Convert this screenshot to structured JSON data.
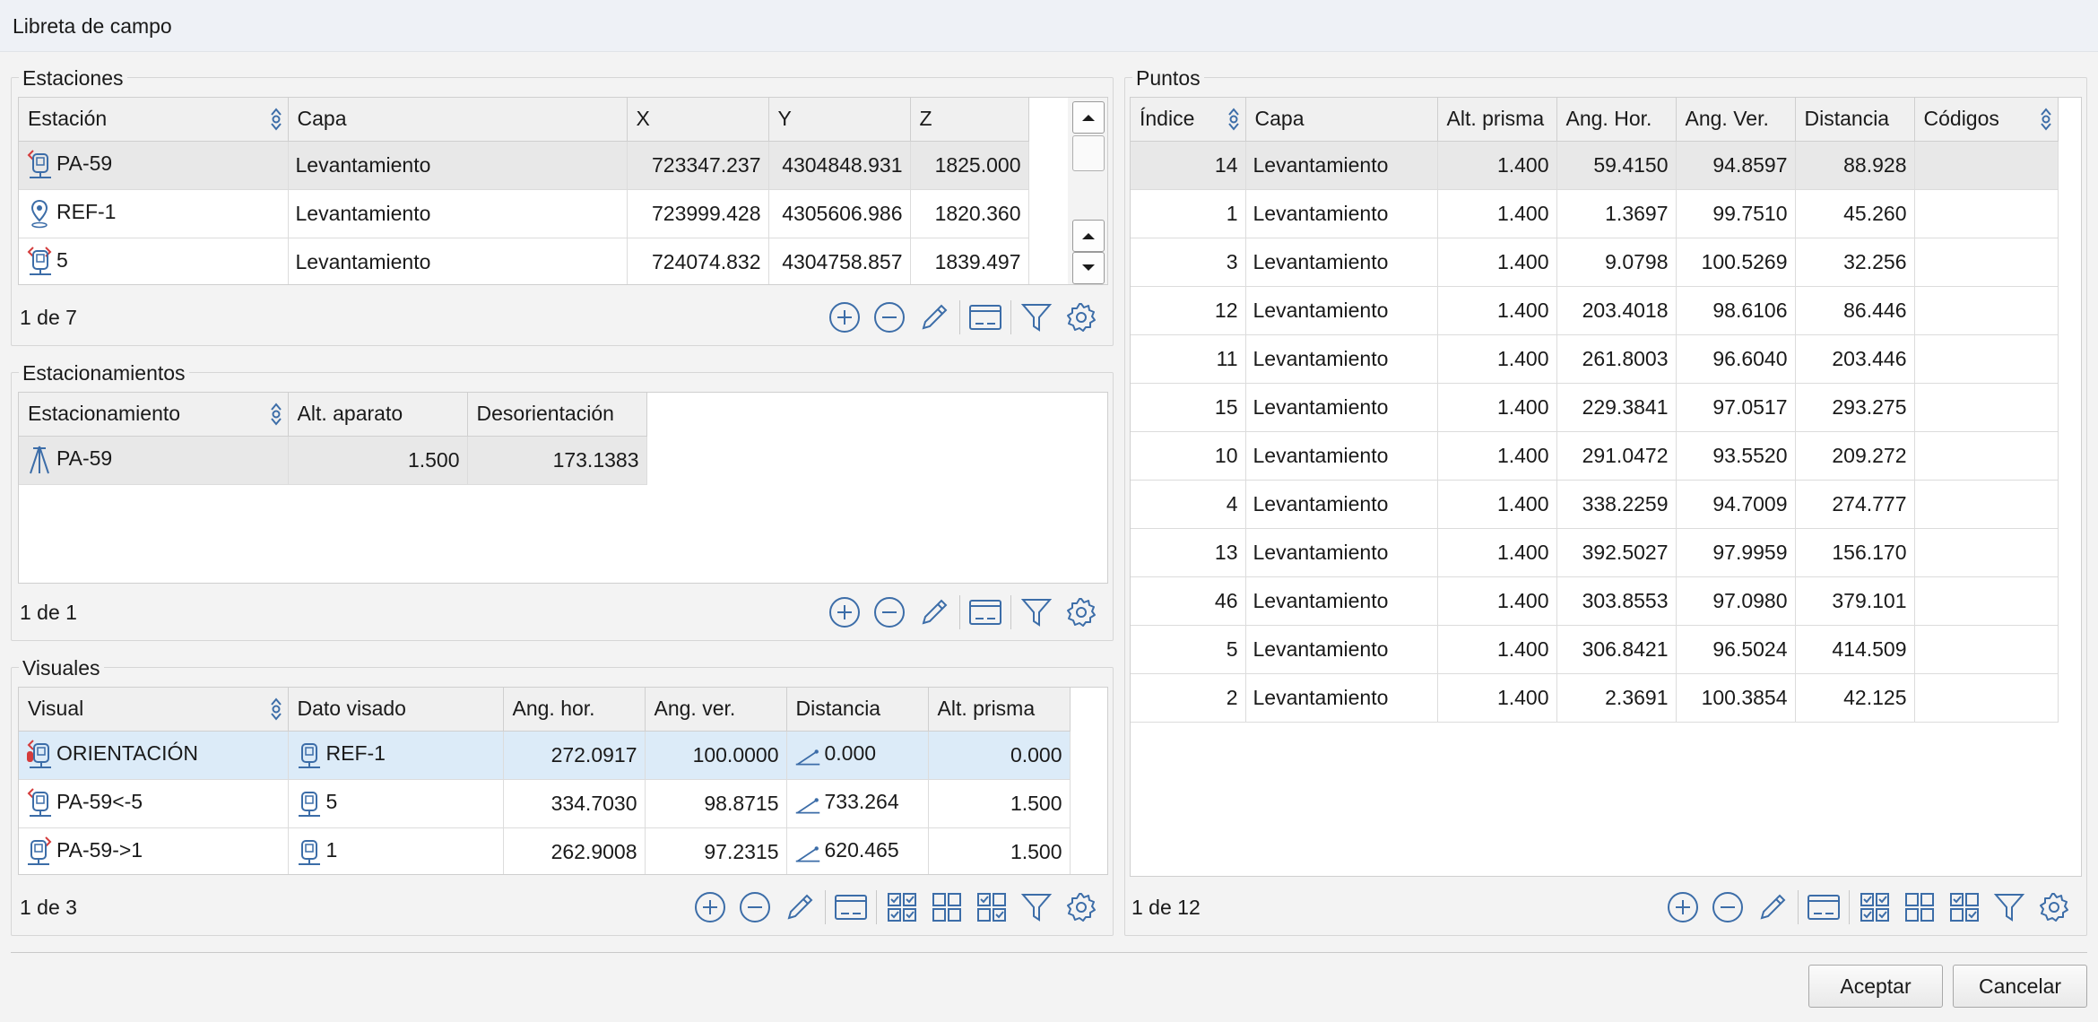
{
  "window": {
    "title": "Libreta de campo"
  },
  "estaciones": {
    "label": "Estaciones",
    "columns": [
      "Estación",
      "Capa",
      "X",
      "Y",
      "Z"
    ],
    "rows": [
      {
        "name": "PA-59",
        "capa": "Levantamiento",
        "x": "723347.237",
        "y": "4304848.931",
        "z": "1825.000",
        "icon": "station-back-icon"
      },
      {
        "name": "REF-1",
        "capa": "Levantamiento",
        "x": "723999.428",
        "y": "4305606.986",
        "z": "1820.360",
        "icon": "reference-pin-icon"
      },
      {
        "name": "5",
        "capa": "Levantamiento",
        "x": "724074.832",
        "y": "4304758.857",
        "z": "1839.497",
        "icon": "station-both-icon"
      }
    ],
    "pager": "1 de 7"
  },
  "estacionamientos": {
    "label": "Estacionamientos",
    "columns": [
      "Estacionamiento",
      "Alt. aparato",
      "Desorientación"
    ],
    "rows": [
      {
        "name": "PA-59",
        "alt": "1.500",
        "desor": "173.1383",
        "icon": "tripod-icon"
      }
    ],
    "pager": "1 de 1"
  },
  "visuales": {
    "label": "Visuales",
    "columns": [
      "Visual",
      "Dato visado",
      "Ang. hor.",
      "Ang. ver.",
      "Distancia",
      "Alt. prisma"
    ],
    "rows": [
      {
        "visual": "ORIENTACIÓN",
        "dato": "REF-1",
        "ah": "272.0917",
        "av": "100.0000",
        "dist": "0.000",
        "alt": "0.000",
        "icon": "orientation-icon"
      },
      {
        "visual": "PA-59<-5",
        "dato": "5",
        "ah": "334.7030",
        "av": "98.8715",
        "dist": "733.264",
        "alt": "1.500",
        "icon": "station-back-icon"
      },
      {
        "visual": "PA-59->1",
        "dato": "1",
        "ah": "262.9008",
        "av": "97.2315",
        "dist": "620.465",
        "alt": "1.500",
        "icon": "station-forward-icon"
      }
    ],
    "pager": "1 de 3"
  },
  "puntos": {
    "label": "Puntos",
    "columns": [
      "Índice",
      "Capa",
      "Alt. prisma",
      "Ang. Hor.",
      "Ang. Ver.",
      "Distancia",
      "Códigos"
    ],
    "rows": [
      {
        "idx": "14",
        "capa": "Levantamiento",
        "alt": "1.400",
        "ah": "59.4150",
        "av": "94.8597",
        "dist": "88.928",
        "cod": ""
      },
      {
        "idx": "1",
        "capa": "Levantamiento",
        "alt": "1.400",
        "ah": "1.3697",
        "av": "99.7510",
        "dist": "45.260",
        "cod": ""
      },
      {
        "idx": "3",
        "capa": "Levantamiento",
        "alt": "1.400",
        "ah": "9.0798",
        "av": "100.5269",
        "dist": "32.256",
        "cod": ""
      },
      {
        "idx": "12",
        "capa": "Levantamiento",
        "alt": "1.400",
        "ah": "203.4018",
        "av": "98.6106",
        "dist": "86.446",
        "cod": ""
      },
      {
        "idx": "11",
        "capa": "Levantamiento",
        "alt": "1.400",
        "ah": "261.8003",
        "av": "96.6040",
        "dist": "203.446",
        "cod": ""
      },
      {
        "idx": "15",
        "capa": "Levantamiento",
        "alt": "1.400",
        "ah": "229.3841",
        "av": "97.0517",
        "dist": "293.275",
        "cod": ""
      },
      {
        "idx": "10",
        "capa": "Levantamiento",
        "alt": "1.400",
        "ah": "291.0472",
        "av": "93.5520",
        "dist": "209.272",
        "cod": ""
      },
      {
        "idx": "4",
        "capa": "Levantamiento",
        "alt": "1.400",
        "ah": "338.2259",
        "av": "94.7009",
        "dist": "274.777",
        "cod": ""
      },
      {
        "idx": "13",
        "capa": "Levantamiento",
        "alt": "1.400",
        "ah": "392.5027",
        "av": "97.9959",
        "dist": "156.170",
        "cod": ""
      },
      {
        "idx": "46",
        "capa": "Levantamiento",
        "alt": "1.400",
        "ah": "303.8553",
        "av": "97.0980",
        "dist": "379.101",
        "cod": ""
      },
      {
        "idx": "5",
        "capa": "Levantamiento",
        "alt": "1.400",
        "ah": "306.8421",
        "av": "96.5024",
        "dist": "414.509",
        "cod": ""
      },
      {
        "idx": "2",
        "capa": "Levantamiento",
        "alt": "1.400",
        "ah": "2.3691",
        "av": "100.3854",
        "dist": "42.125",
        "cod": ""
      }
    ],
    "pager": "1 de 12"
  },
  "buttons": {
    "accept": "Aceptar",
    "cancel": "Cancelar"
  },
  "colors": {
    "icon_blue": "#3c6da8",
    "icon_red": "#d43c3c",
    "selection_blue": "#dcebf8",
    "selection_gray": "#e8e8e8"
  }
}
